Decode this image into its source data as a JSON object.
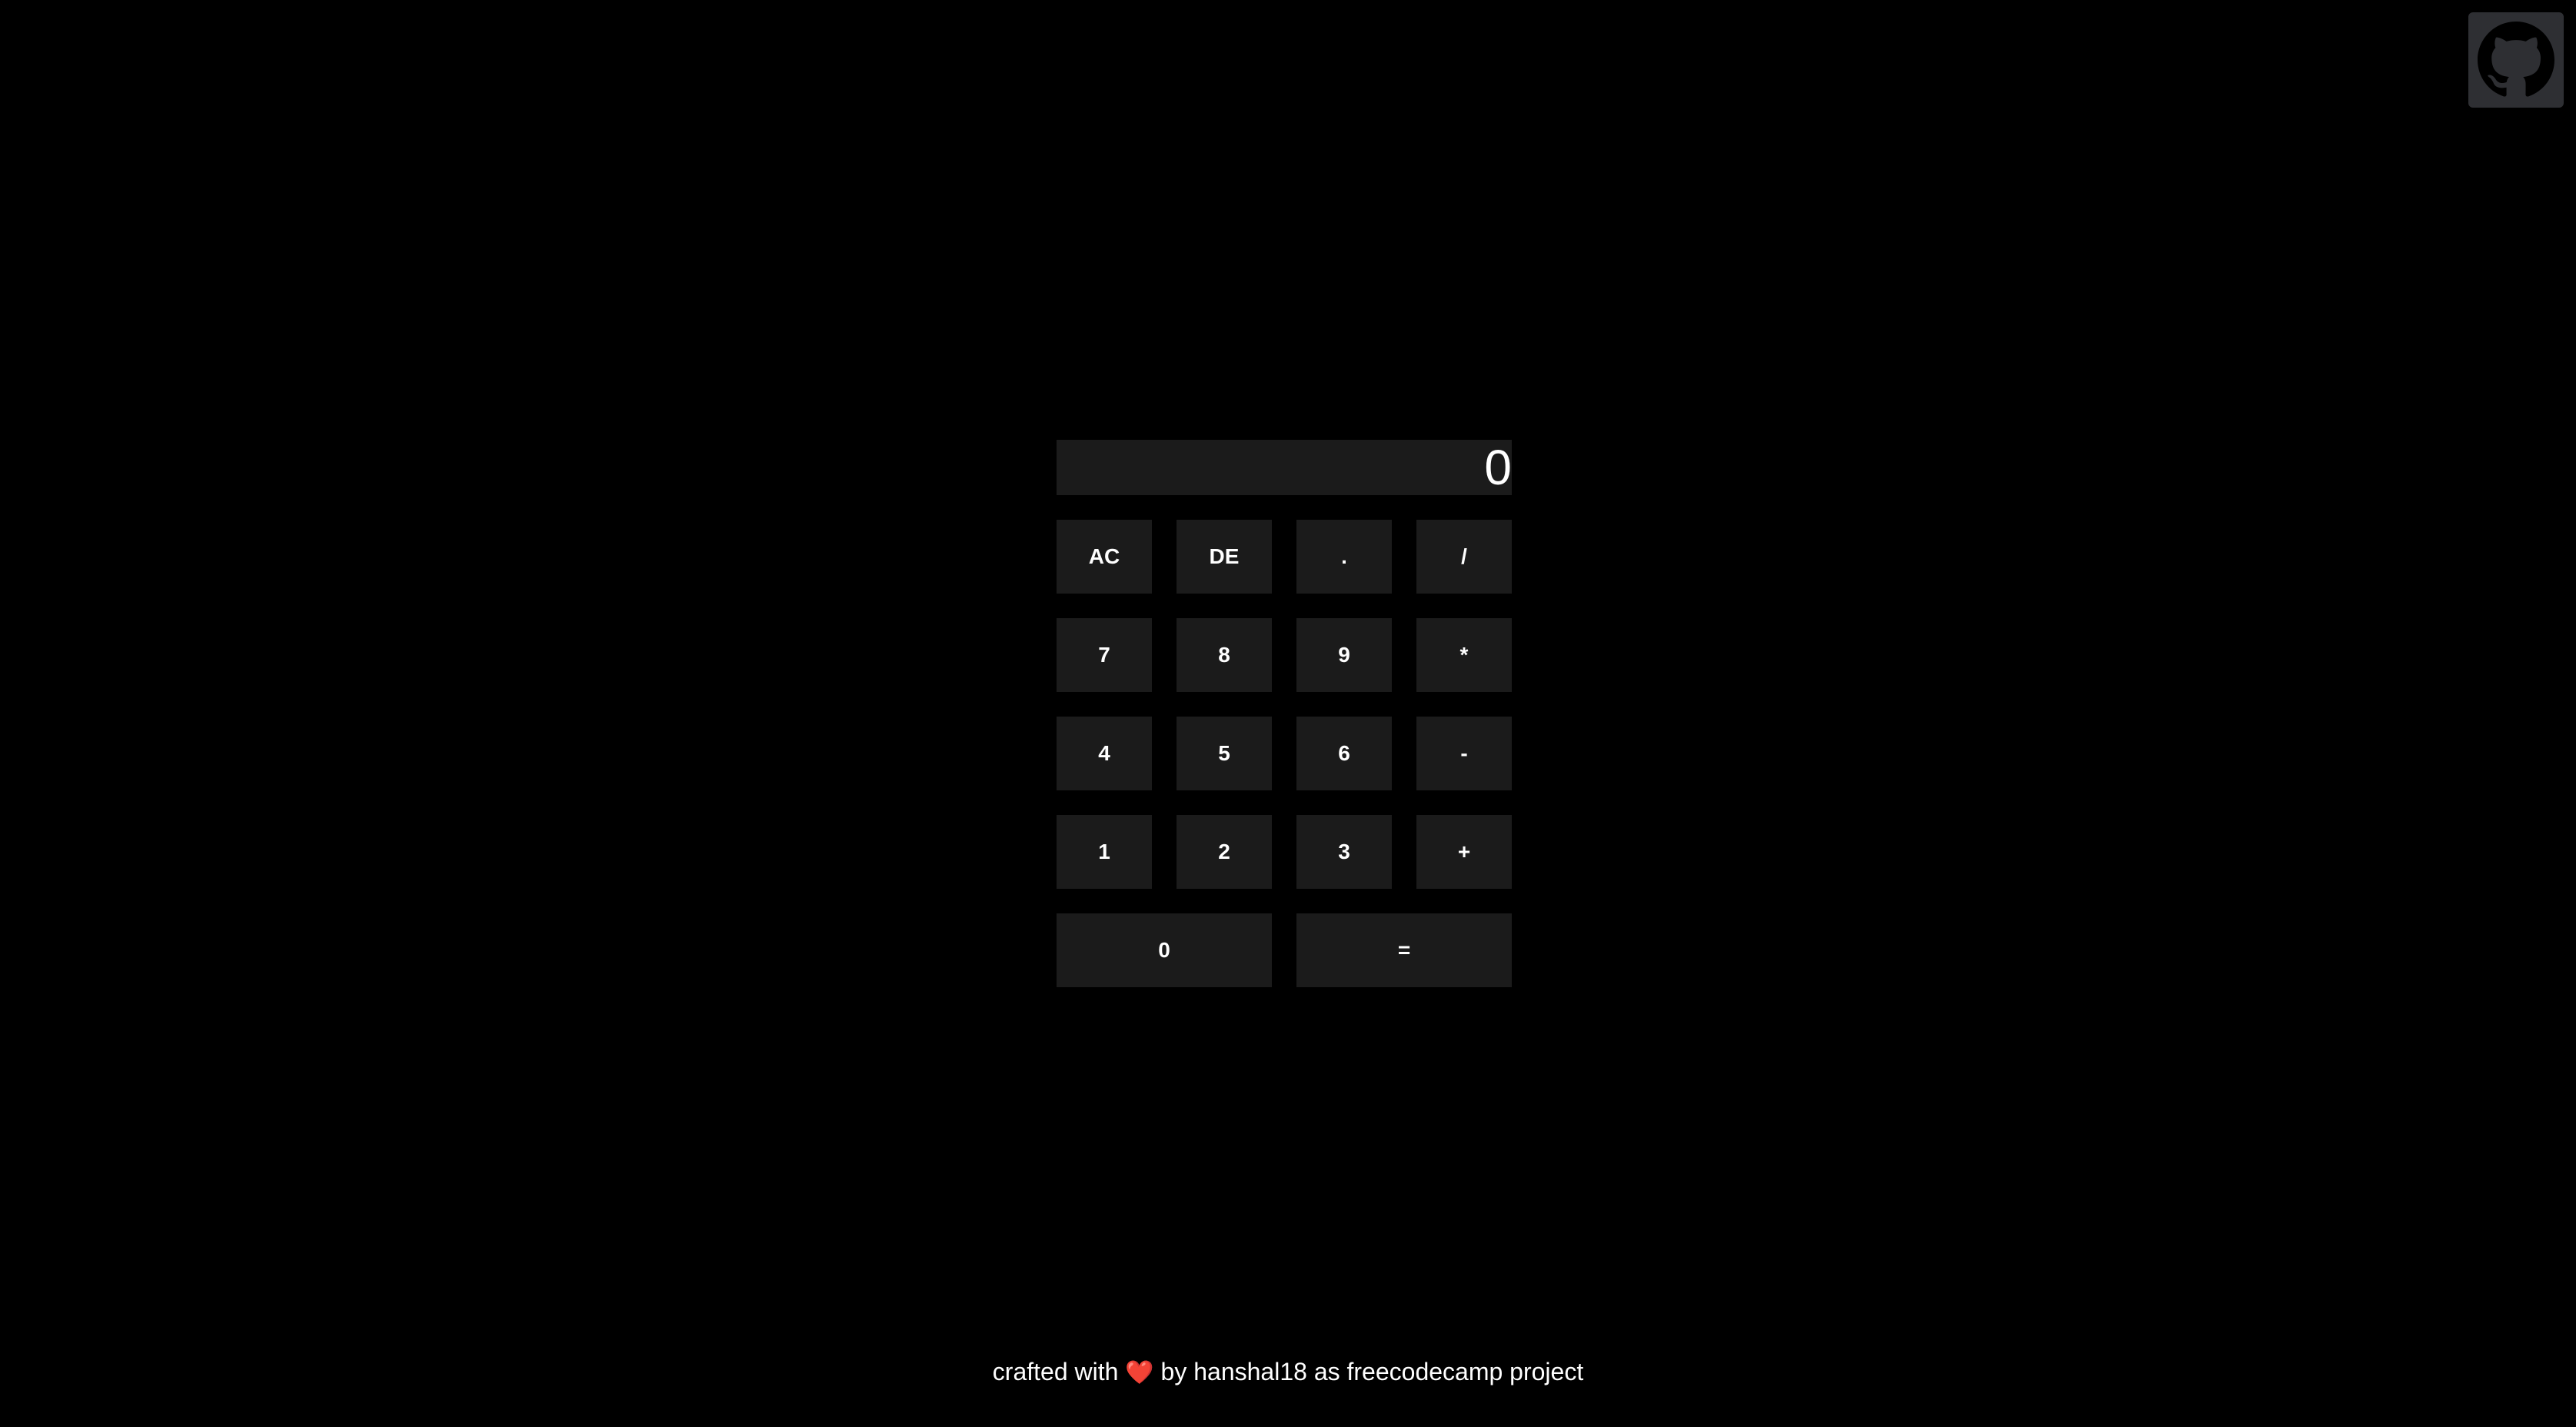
{
  "display": {
    "value": "0"
  },
  "keys": {
    "ac": "AC",
    "de": "DE",
    "dot": ".",
    "divide": "/",
    "seven": "7",
    "eight": "8",
    "nine": "9",
    "multiply": "*",
    "four": "4",
    "five": "5",
    "six": "6",
    "subtract": "-",
    "one": "1",
    "two": "2",
    "three": "3",
    "add": "+",
    "zero": "0",
    "equals": "="
  },
  "footer": {
    "prefix": "crafted with",
    "heart": "❤️",
    "by": "by",
    "author": "hanshal18",
    "as": "as",
    "project": "freecodecamp project"
  },
  "icons": {
    "github": "github-icon"
  },
  "colors": {
    "background": "#000000",
    "key": "#1b1b1b",
    "text": "#ffffff",
    "github_tile": "#2e2f33"
  }
}
